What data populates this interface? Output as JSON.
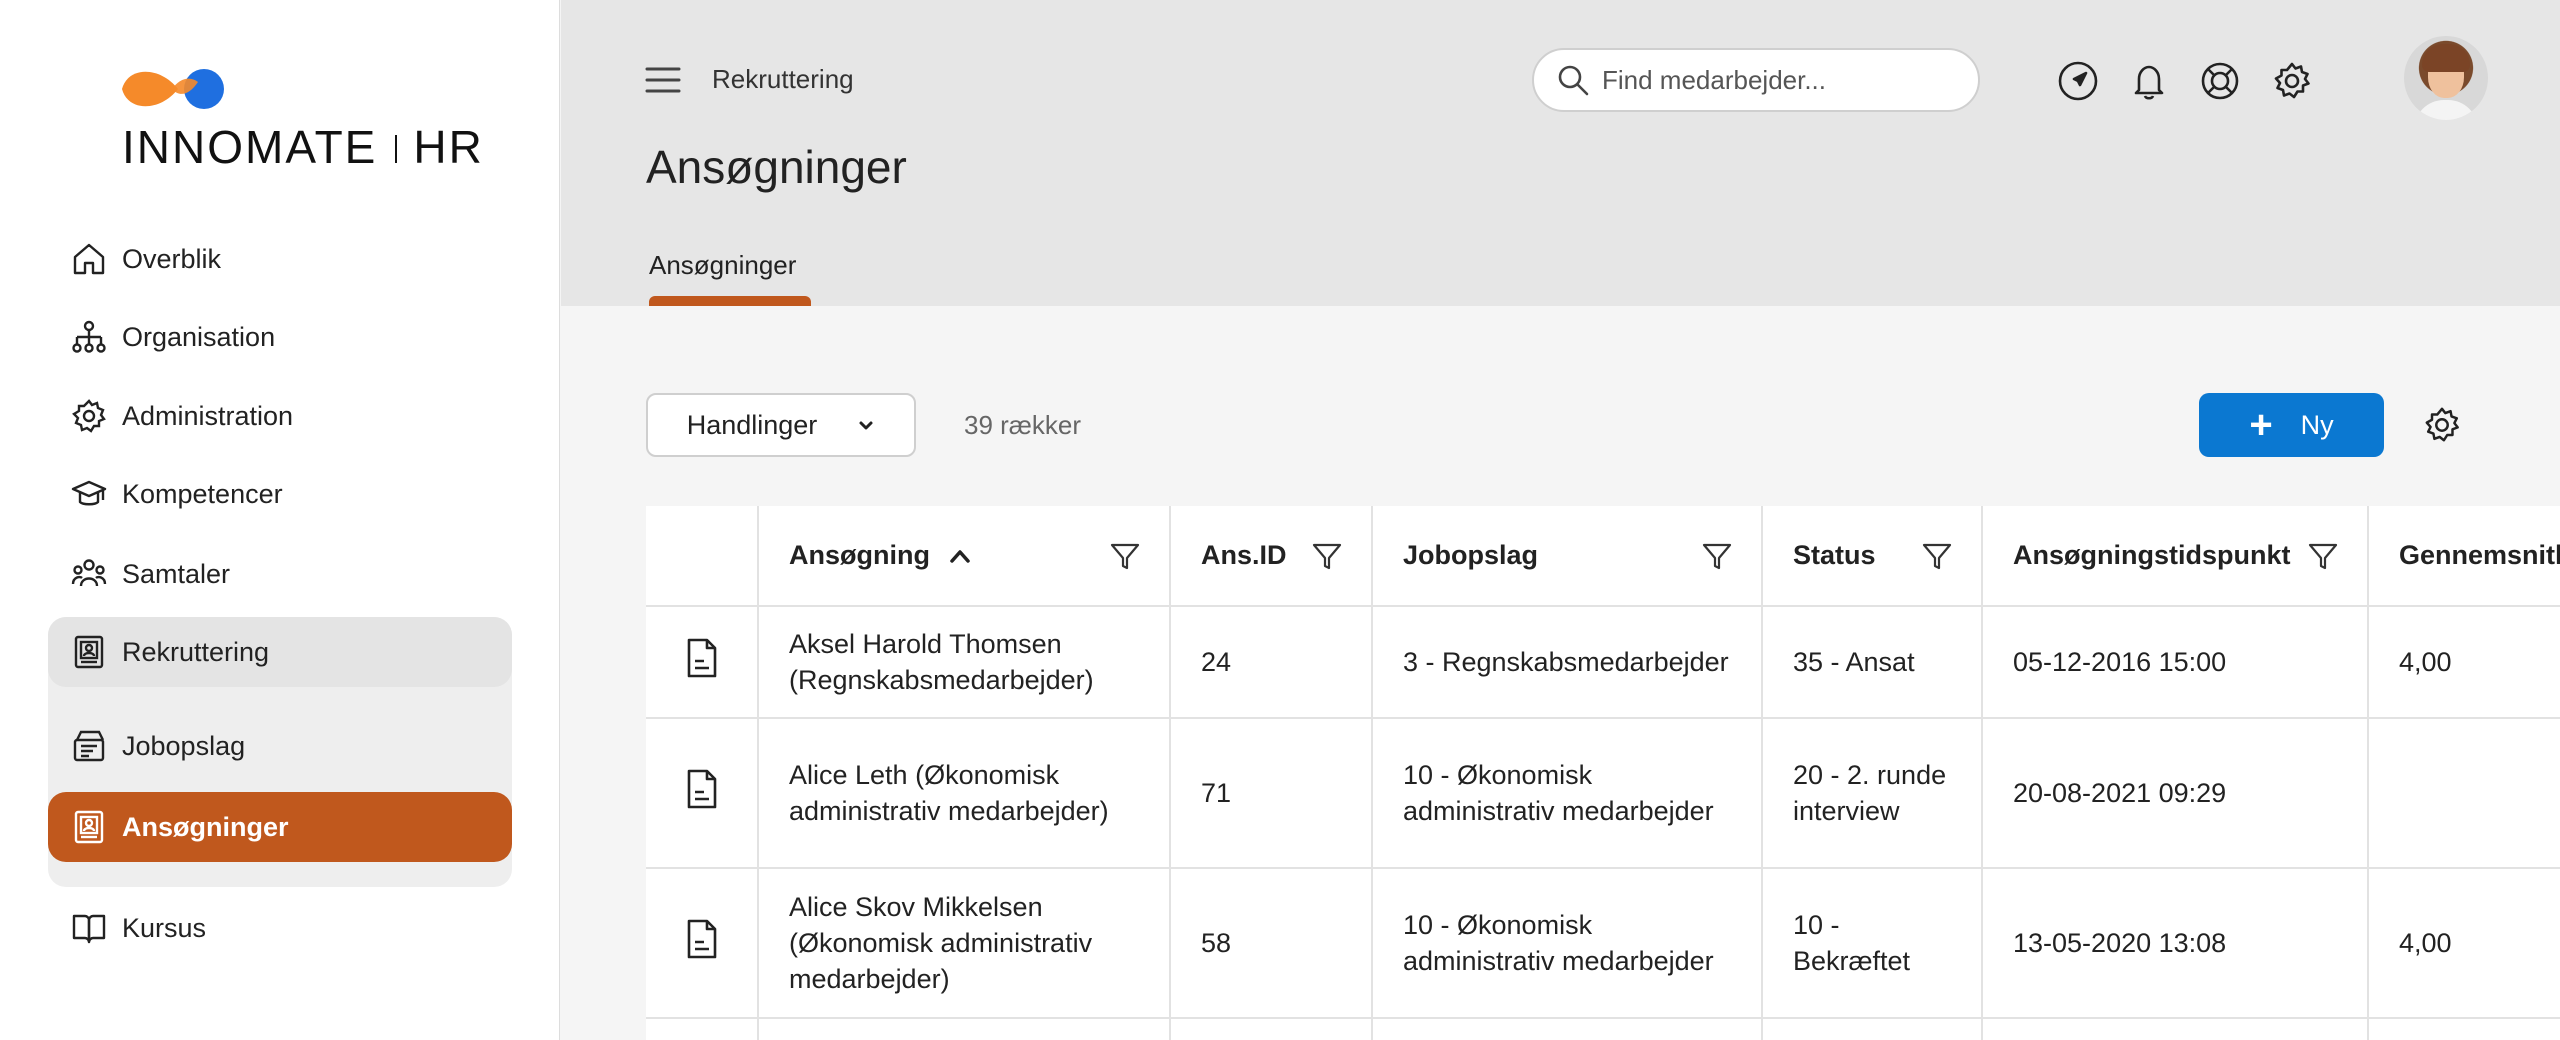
{
  "logo": {
    "text_light": "INNO",
    "text_bold": "MATE",
    "text_suffix": "HR"
  },
  "sidebar": {
    "items": [
      {
        "label": "Overblik",
        "icon": "home-icon"
      },
      {
        "label": "Organisation",
        "icon": "org-chart-icon"
      },
      {
        "label": "Administration",
        "icon": "gear-icon"
      },
      {
        "label": "Kompetencer",
        "icon": "graduation-cap-icon"
      },
      {
        "label": "Samtaler",
        "icon": "people-icon"
      },
      {
        "label": "Rekruttering",
        "icon": "id-badge-icon"
      },
      {
        "label": "Jobopslag",
        "icon": "job-posting-icon"
      },
      {
        "label": "Ansøgninger",
        "icon": "id-badge-icon"
      },
      {
        "label": "Kursus",
        "icon": "book-icon"
      }
    ]
  },
  "header": {
    "breadcrumb": "Rekruttering",
    "search_placeholder": "Find medarbejder...",
    "page_title": "Ansøgninger",
    "tabs": [
      {
        "label": "Ansøgninger",
        "active": true
      }
    ],
    "icons": [
      "navigation-icon",
      "bell-icon",
      "lifebuoy-icon",
      "gear-icon"
    ]
  },
  "toolbar": {
    "actions_label": "Handlinger",
    "row_count": "39 rækker",
    "new_label": "Ny"
  },
  "table": {
    "columns": [
      "",
      "Ansøgning",
      "Ans.ID",
      "Jobopslag",
      "Status",
      "Ansøgningstidspunkt",
      "Gennemsnitli"
    ],
    "rows": [
      [
        "Aksel Harold Thomsen (Regnskabsmedarbejder)",
        "24",
        "3 - Regnskabsmedarbejder",
        "35 - Ansat",
        "05-12-2016 15:00",
        "4,00"
      ],
      [
        "Alice Leth (Økonomisk administrativ medarbejder)",
        "71",
        "10 - Økonomisk administrativ medarbejder",
        "20 - 2. runde interview",
        "20-08-2021 09:29",
        ""
      ],
      [
        "Alice Skov Mikkelsen (Økonomisk administrativ medarbejder)",
        "58",
        "10 - Økonomisk administrativ medarbejder",
        "10 - Bekræftet",
        "13-05-2020 13:08",
        "4,00"
      ]
    ]
  },
  "colors": {
    "accent": "#c0581d",
    "primary": "#0b78d1",
    "logo_orange": "#f58a2a",
    "logo_blue": "#1f6fe0"
  }
}
